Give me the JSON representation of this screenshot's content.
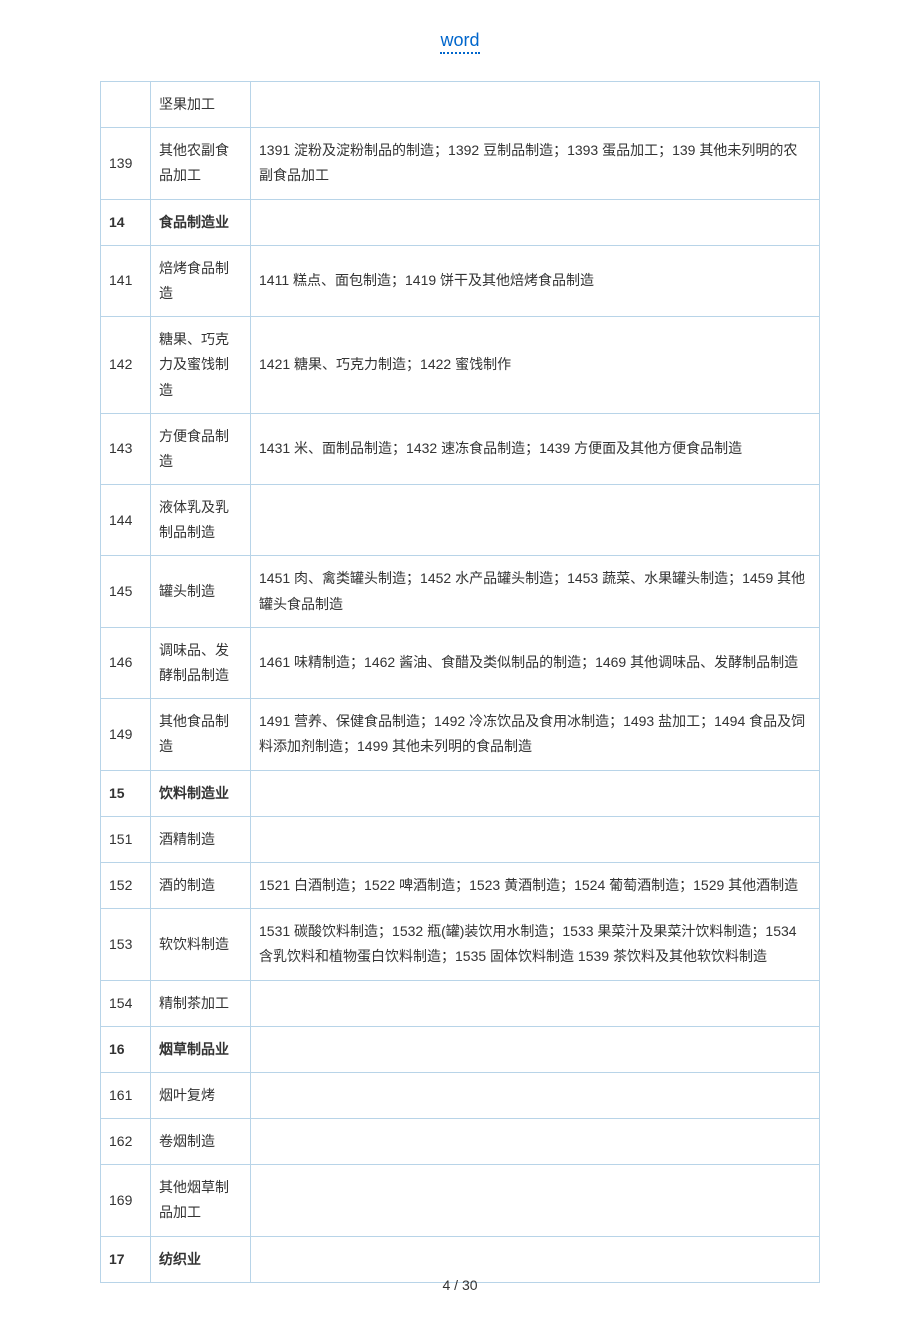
{
  "header": {
    "link": "word"
  },
  "footer": {
    "page": "4 / 30"
  },
  "rows": [
    {
      "code": "",
      "name": "坚果加工",
      "desc": "",
      "bold": false
    },
    {
      "code": "139",
      "name": "其他农副食品加工",
      "desc": "1391 淀粉及淀粉制品的制造；1392 豆制品制造；1393 蛋品加工；139 其他未列明的农副食品加工",
      "bold": false
    },
    {
      "code": "14",
      "name": "食品制造业",
      "desc": "",
      "bold": true
    },
    {
      "code": "141",
      "name": "焙烤食品制造",
      "desc": "1411 糕点、面包制造；1419 饼干及其他焙烤食品制造",
      "bold": false
    },
    {
      "code": "142",
      "name": "糖果、巧克力及蜜饯制造",
      "desc": "1421 糖果、巧克力制造；1422 蜜饯制作",
      "bold": false
    },
    {
      "code": "143",
      "name": "方便食品制造",
      "desc": "1431 米、面制品制造；1432 速冻食品制造；1439 方便面及其他方便食品制造",
      "bold": false
    },
    {
      "code": "144",
      "name": "液体乳及乳制品制造",
      "desc": "",
      "bold": false
    },
    {
      "code": "145",
      "name": "罐头制造",
      "desc": "1451 肉、禽类罐头制造；1452 水产品罐头制造；1453 蔬菜、水果罐头制造；1459 其他罐头食品制造",
      "bold": false
    },
    {
      "code": "146",
      "name": "调味品、发酵制品制造",
      "desc": "1461 味精制造；1462 酱油、食醋及类似制品的制造；1469 其他调味品、发酵制品制造",
      "bold": false
    },
    {
      "code": "149",
      "name": "其他食品制造",
      "desc": "1491 营养、保健食品制造；1492 冷冻饮品及食用冰制造；1493 盐加工；1494 食品及饲料添加剂制造；1499 其他未列明的食品制造",
      "bold": false
    },
    {
      "code": "15",
      "name": "饮料制造业",
      "desc": "",
      "bold": true
    },
    {
      "code": "151",
      "name": "酒精制造",
      "desc": "",
      "bold": false
    },
    {
      "code": "152",
      "name": "酒的制造",
      "desc": "1521 白酒制造；1522 啤酒制造；1523 黄酒制造；1524 葡萄酒制造；1529 其他酒制造",
      "bold": false
    },
    {
      "code": "153",
      "name": "软饮料制造",
      "desc": "1531 碳酸饮料制造；1532 瓶(罐)装饮用水制造；1533 果菜汁及果菜汁饮料制造；1534 含乳饮料和植物蛋白饮料制造；1535 固体饮料制造 1539 茶饮料及其他软饮料制造",
      "bold": false
    },
    {
      "code": "154",
      "name": "精制茶加工",
      "desc": "",
      "bold": false
    },
    {
      "code": "16",
      "name": "烟草制品业",
      "desc": "",
      "bold": true
    },
    {
      "code": "161",
      "name": "烟叶复烤",
      "desc": "",
      "bold": false
    },
    {
      "code": "162",
      "name": "卷烟制造",
      "desc": "",
      "bold": false
    },
    {
      "code": "169",
      "name": "其他烟草制品加工",
      "desc": "",
      "bold": false
    },
    {
      "code": "17",
      "name": "纺织业",
      "desc": "",
      "bold": true
    }
  ]
}
